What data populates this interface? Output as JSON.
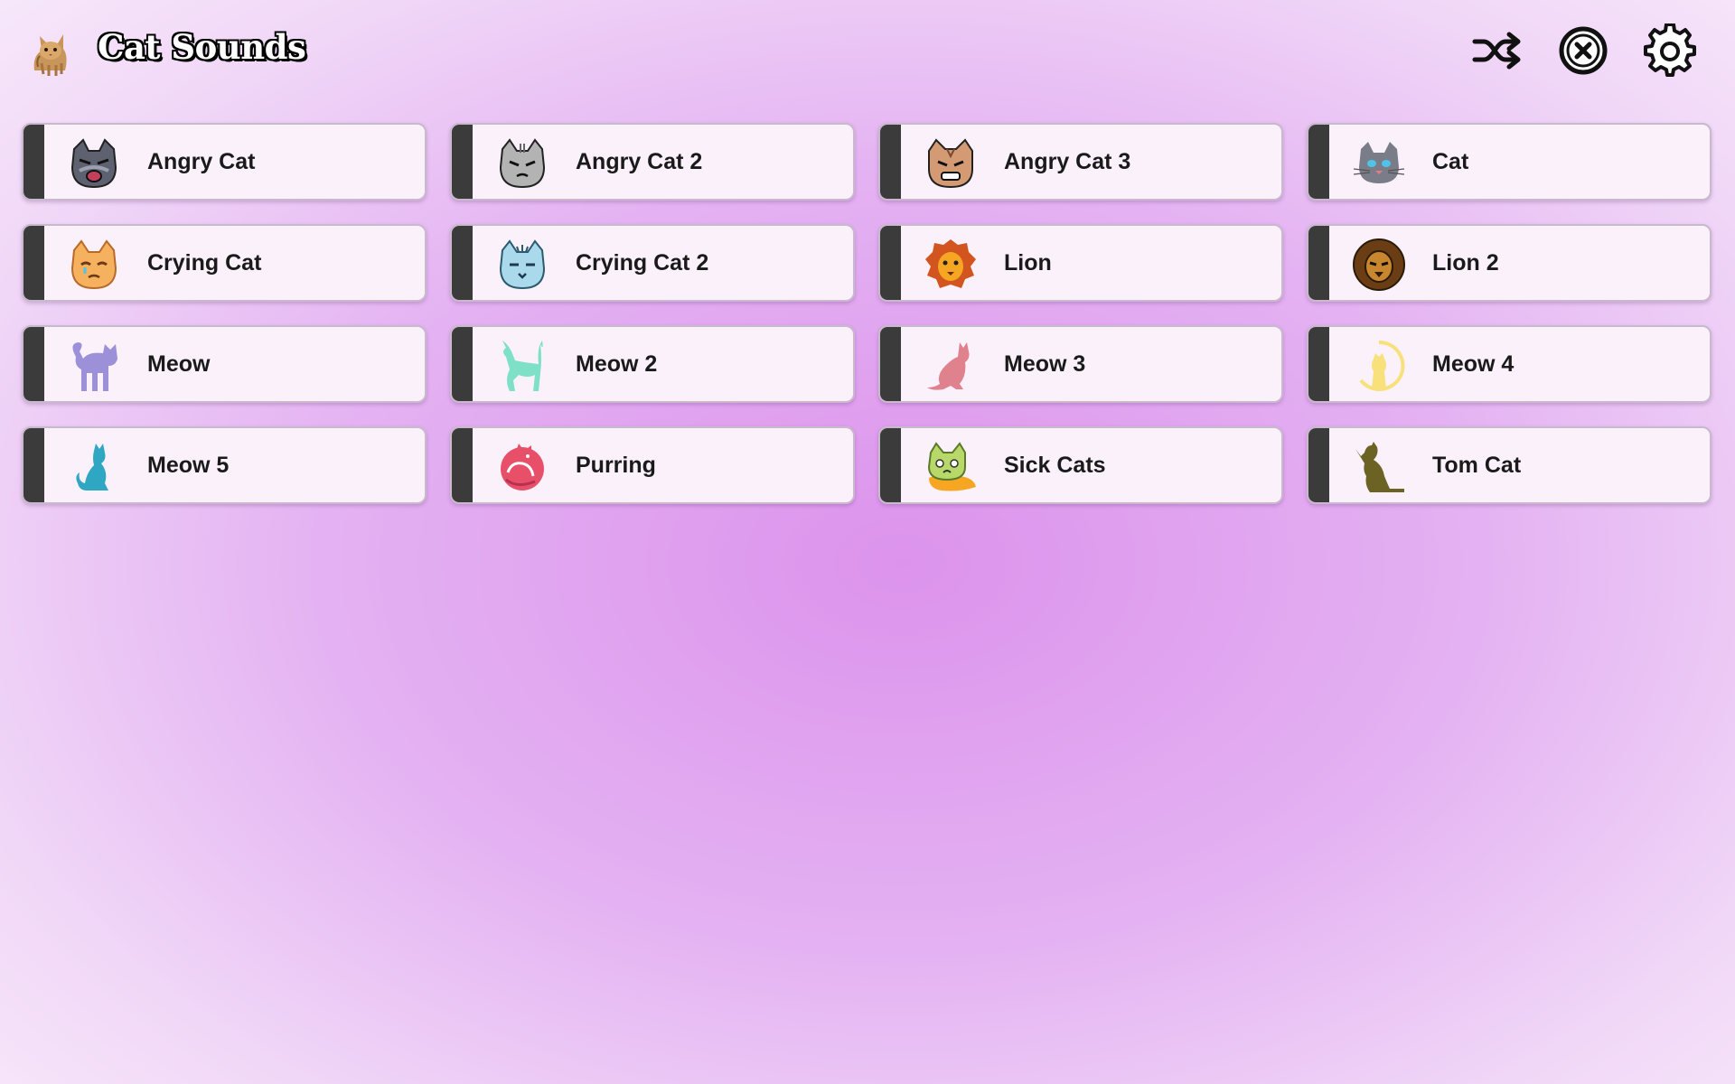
{
  "app": {
    "title": "Cat Sounds",
    "logo_icon": "cat-photo-icon"
  },
  "header_buttons": [
    {
      "name": "shuffle-button",
      "icon": "shuffle-icon"
    },
    {
      "name": "stop-button",
      "icon": "close-circle-icon"
    },
    {
      "name": "settings-button",
      "icon": "gear-icon"
    }
  ],
  "colors": {
    "card_accent_bar": "#3b3b3b",
    "card_background": "#faf1fb",
    "background_center": "#dc93ec"
  },
  "sounds": [
    {
      "label": "Angry Cat",
      "icon": "angry-cat-face-icon"
    },
    {
      "label": "Angry Cat 2",
      "icon": "angry-cat-face-2-icon"
    },
    {
      "label": "Angry Cat 3",
      "icon": "angry-cat-face-3-icon"
    },
    {
      "label": "Cat",
      "icon": "cat-face-icon"
    },
    {
      "label": "Crying Cat",
      "icon": "crying-cat-face-icon"
    },
    {
      "label": "Crying Cat 2",
      "icon": "crying-cat-face-2-icon"
    },
    {
      "label": "Lion",
      "icon": "lion-face-icon"
    },
    {
      "label": "Lion 2",
      "icon": "lion-face-2-icon"
    },
    {
      "label": "Meow",
      "icon": "cat-silhouette-icon"
    },
    {
      "label": "Meow 2",
      "icon": "cat-silhouette-2-icon"
    },
    {
      "label": "Meow 3",
      "icon": "cat-silhouette-3-icon"
    },
    {
      "label": "Meow 4",
      "icon": "cat-moon-icon"
    },
    {
      "label": "Meow 5",
      "icon": "cat-silhouette-5-icon"
    },
    {
      "label": "Purring",
      "icon": "curled-cat-icon"
    },
    {
      "label": "Sick Cats",
      "icon": "sick-cat-icon"
    },
    {
      "label": "Tom Cat",
      "icon": "tom-cat-silhouette-icon"
    }
  ]
}
